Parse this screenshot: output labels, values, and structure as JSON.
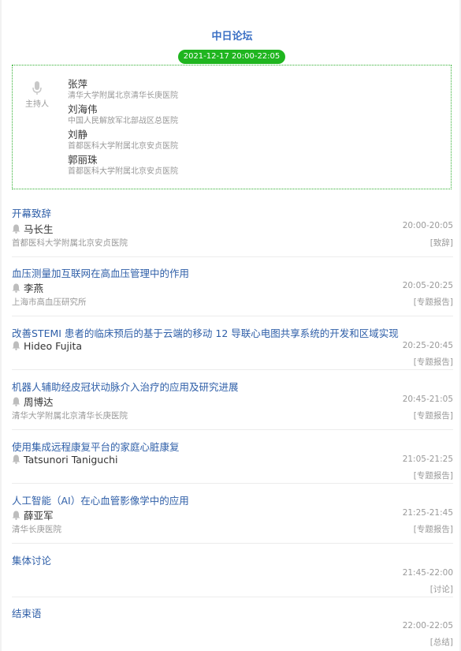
{
  "forum": {
    "title": "中日论坛",
    "time": "2021-12-17 20:00-22:05",
    "host_label": "主持人",
    "hosts": [
      {
        "name": "张萍",
        "org": "清华大学附属北京清华长庚医院"
      },
      {
        "name": "刘海伟",
        "org": "中国人民解放军北部战区总医院"
      },
      {
        "name": "刘静",
        "org": "首都医科大学附属北京安贞医院"
      },
      {
        "name": "郭丽珠",
        "org": "首都医科大学附属北京安贞医院"
      }
    ]
  },
  "sessions": [
    {
      "title": "开幕致辞",
      "speaker": "马长生",
      "org": "首都医科大学附属北京安贞医院",
      "time": "20:00-20:05",
      "type": "[致辞]"
    },
    {
      "title": "血压测量加互联网在高血压管理中的作用",
      "speaker": "李燕",
      "org": "上海市高血压研究所",
      "time": "20:05-20:25",
      "type": "[专题报告]"
    },
    {
      "title": "改善STEMI 患者的临床预后的基于云端的移动 12 导联心电图共享系统的开发和区域实现",
      "speaker": "Hideo Fujita",
      "org": "",
      "time": "20:25-20:45",
      "type": "[专题报告]"
    },
    {
      "title": "机器人辅助经皮冠状动脉介入治疗的应用及研究进展",
      "speaker": "周博达",
      "org": "清华大学附属北京清华长庚医院",
      "time": "20:45-21:05",
      "type": "[专题报告]"
    },
    {
      "title": "使用集成远程康复平台的家庭心脏康复",
      "speaker": "Tatsunori Taniguchi",
      "org": "",
      "time": "21:05-21:25",
      "type": "[专题报告]"
    },
    {
      "title": "人工智能（AI）在心血管影像学中的应用",
      "speaker": "薛亚军",
      "org": "清华长庚医院",
      "time": "21:25-21:45",
      "type": "[专题报告]"
    },
    {
      "title": "集体讨论",
      "speaker": "",
      "org": "",
      "time": "21:45-22:00",
      "type": "[讨论]"
    },
    {
      "title": "结束语",
      "speaker": "",
      "org": "",
      "time": "22:00-22:05",
      "type": "[总结]"
    }
  ]
}
